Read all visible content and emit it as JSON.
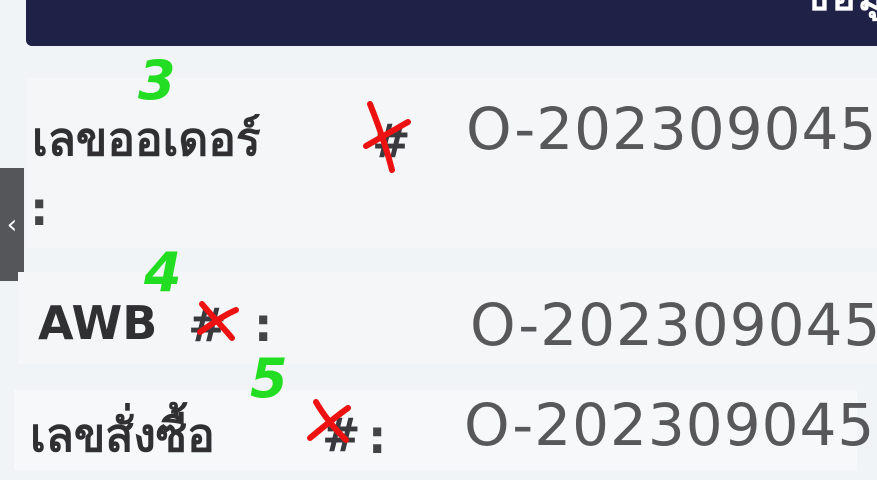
{
  "header": {
    "text": "ข้อมู"
  },
  "sidebar_toggle": {
    "icon": "chevron-left-icon",
    "glyph": "‹"
  },
  "fields": [
    {
      "label": "เลขออเดอร์",
      "hash": "#",
      "colon": ":",
      "value": "O-202309045",
      "annotation": "3"
    },
    {
      "label": "AWB",
      "hash": "#",
      "colon": ":",
      "value": "O-202309045",
      "annotation": "4"
    },
    {
      "label": "เลขสั่งซื้อ",
      "hash": "#",
      "colon": ":",
      "value": "O-202309045",
      "annotation": "5"
    }
  ],
  "colors": {
    "header_bg": "#1f2147",
    "annotation_number": "#22dd22",
    "annotation_cross": "#ee1111",
    "page_bg": "#f1f4f6"
  }
}
